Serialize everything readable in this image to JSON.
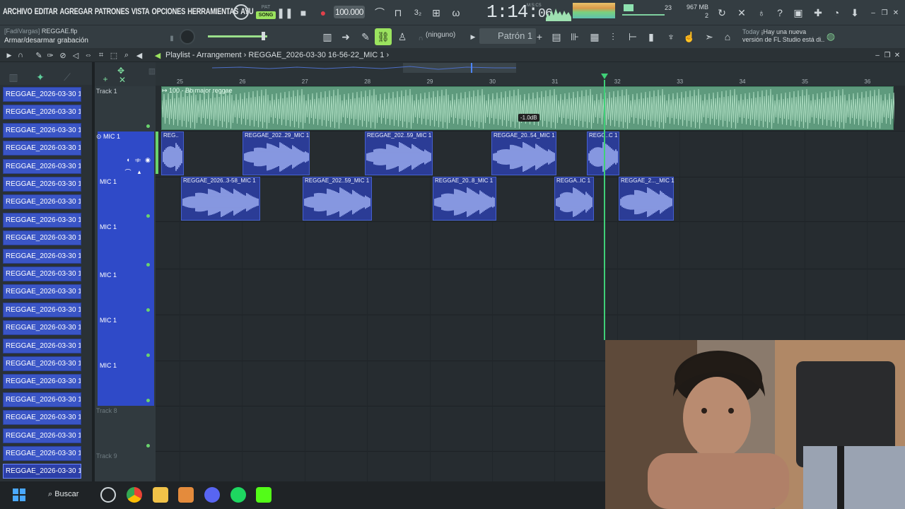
{
  "menu": [
    "ARCHIVO",
    "EDITAR",
    "AGREGAR",
    "PATRONES",
    "VISTA",
    "OPCIONES",
    "HERRAMIENTAS",
    "AYU"
  ],
  "transport": {
    "pat_label": "PAT",
    "song_label": "SONG",
    "tempo": "100.000",
    "time_main": "1:14",
    "time_sub": "06",
    "time_unit": "M:S:CS"
  },
  "meters": {
    "cpu": "23",
    "memory": "967 MB",
    "voices": "2"
  },
  "file": {
    "user": "[FadiVargas]",
    "name": "REGGAE.flp",
    "hint": "Armar/desarmar grabación"
  },
  "snap": "(ninguno)",
  "pattern": "Patrón 1",
  "news": {
    "date": "Today",
    "line1": "¡Hay una nueva",
    "line2": "versión de FL Studio está di.."
  },
  "playlist": {
    "breadcrumb": "Playlist - Arrangement",
    "sep": "›",
    "clip": "REGGAE_2026-03-30 16-56-22_MIC 1",
    "sep2": "›"
  },
  "browser_clips": [
    "REGGAE_2026-03-30 16-...",
    "REGGAE_2026-03-30 16-...",
    "REGGAE_2026-03-30 16-...",
    "REGGAE_2026-03-30 16-...",
    "REGGAE_2026-03-30 16-...",
    "REGGAE_2026-03-30 16-...",
    "REGGAE_2026-03-30 16-...",
    "REGGAE_2026-03-30 16-...",
    "REGGAE_2026-03-30 16-...",
    "REGGAE_2026-03-30 16-...",
    "REGGAE_2026-03-30 16-...",
    "REGGAE_2026-03-30 16-...",
    "REGGAE_2026-03-30 16-...",
    "REGGAE_2026-03-30 16-...",
    "REGGAE_2026-03-30 16-...",
    "REGGAE_2026-03-30 16-...",
    "REGGAE_2026-03-30 16-...",
    "REGGAE_2026-03-30 16-...",
    "REGGAE_2026-03-30 16-...",
    "REGGAE_2026-03-30 16-...",
    "REGGAE_2026-03-30 16-...",
    "REGGAE_2026-03-30 16-..."
  ],
  "tracks": {
    "t1": "Track 1",
    "mic_a": "MIC 1",
    "mic_b": "MIC 1",
    "mic_c": "MIC 1",
    "mic_d": "MIC 1",
    "mic_e": "MIC 1",
    "mic_f": "MIC 1",
    "t8": "Track 8",
    "t9": "Track 9"
  },
  "ruler": [
    "25",
    "26",
    "27",
    "28",
    "29",
    "30",
    "31",
    "32",
    "33",
    "34",
    "35",
    "36"
  ],
  "audio_track": {
    "title": "100 - Bb major reggae",
    "db": "-1.0dB"
  },
  "clips_row1": [
    "REG..",
    "REGGAE_202..29_MIC 1",
    "REGGAE_202..59_MIC 1",
    "REGGAE_20..54_MIC 1",
    "REGG..C 1"
  ],
  "clips_row2": [
    "REGGAE_2026..3-58_MIC 1",
    "REGGAE_202..59_MIC 1",
    "REGGAE_20..8_MIC 1",
    "REGGA..IC 1",
    "REGGAE_2..._MIC 1"
  ],
  "taskbar": {
    "search": "Buscar"
  },
  "colors": {
    "accent": "#9be35f",
    "clip": "#2b3c96",
    "audio": "#5e9a7d",
    "browser_item": "#3a55c6"
  }
}
